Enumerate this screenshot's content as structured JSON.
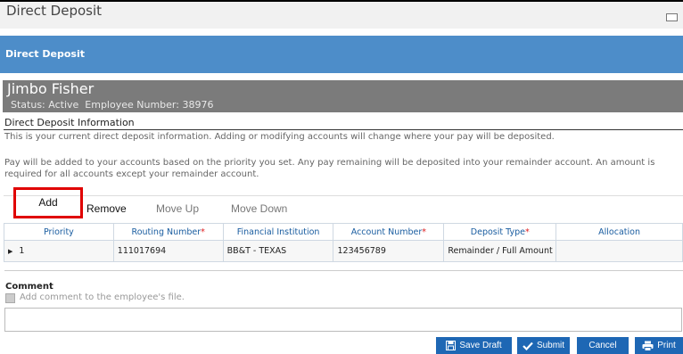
{
  "window": {
    "title": "Direct Deposit"
  },
  "panel": {
    "title": "Direct Deposit"
  },
  "employee": {
    "name": "Jimbo Fisher",
    "status": "Status: Active",
    "employee_number": "Employee Number: 38976"
  },
  "section": {
    "title": "Direct Deposit Information",
    "description": "This is your current direct deposit information. Adding or modifying accounts will change where your pay will be deposited.",
    "note": "Pay will be added to your accounts based on the priority you set. Any pay remaining will be deposited into your remainder account. An amount is required for all accounts except your remainder account."
  },
  "toolbar": {
    "add_label": "Add",
    "remove_label": "Remove",
    "move_up_label": "Move Up",
    "move_down_label": "Move Down"
  },
  "table": {
    "headers": {
      "priority": "Priority",
      "routing": "Routing Number",
      "institution": "Financial Institution",
      "account": "Account Number",
      "deposit_type": "Deposit Type",
      "allocation": "Allocation"
    },
    "required_mark": "*",
    "rows": [
      {
        "priority": "1",
        "routing": "111017694",
        "institution": "BB&T - TEXAS",
        "account": "123456789",
        "deposit_type": "Remainder / Full Amount",
        "allocation": ""
      }
    ]
  },
  "comment": {
    "label": "Comment",
    "checkbox_label": "Add comment to the employee's file.",
    "value": ""
  },
  "actions": {
    "save_draft": "Save Draft",
    "submit": "Submit",
    "cancel": "Cancel",
    "print": "Print"
  },
  "colors": {
    "primary": "#1e67b4",
    "header_bar": "#4d8dc9",
    "employee_bar": "#7b7b7b",
    "highlight": "#e00000"
  }
}
